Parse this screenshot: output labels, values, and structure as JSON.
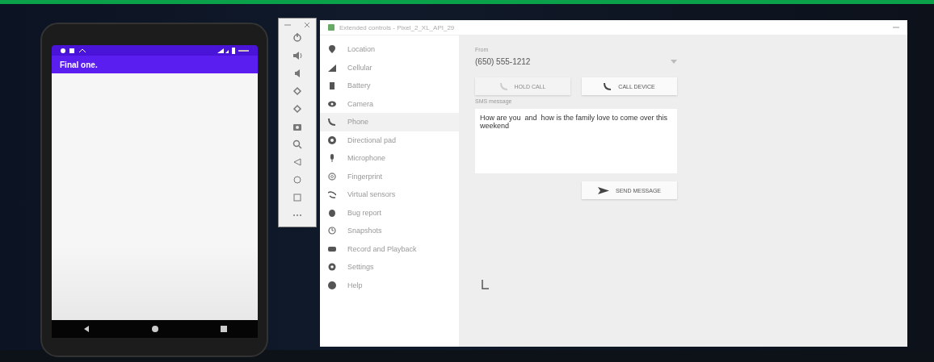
{
  "phone_app": {
    "title": "Final one."
  },
  "window": {
    "title": "Extended controls - Pixel_2_XL_API_29"
  },
  "sidebar": {
    "items": [
      {
        "label": "Location",
        "selected": false
      },
      {
        "label": "Cellular",
        "selected": false
      },
      {
        "label": "Battery",
        "selected": false
      },
      {
        "label": "Camera",
        "selected": false
      },
      {
        "label": "Phone",
        "selected": true
      },
      {
        "label": "Directional pad",
        "selected": false
      },
      {
        "label": "Microphone",
        "selected": false
      },
      {
        "label": "Fingerprint",
        "selected": false
      },
      {
        "label": "Virtual sensors",
        "selected": false
      },
      {
        "label": "Bug report",
        "selected": false
      },
      {
        "label": "Snapshots",
        "selected": false
      },
      {
        "label": "Record and Playback",
        "selected": false
      },
      {
        "label": "Settings",
        "selected": false
      },
      {
        "label": "Help",
        "selected": false
      }
    ]
  },
  "phone_panel": {
    "from_label": "From",
    "from_value": "(650) 555-1212",
    "buttons": [
      {
        "label": "HOLD CALL",
        "disabled": true
      },
      {
        "label": "CALL DEVICE",
        "disabled": false
      }
    ],
    "sms_label": "SMS message",
    "sms_value": "How are you  and  how is the family love to come over this weekend",
    "send_button": "SEND MESSAGE"
  }
}
